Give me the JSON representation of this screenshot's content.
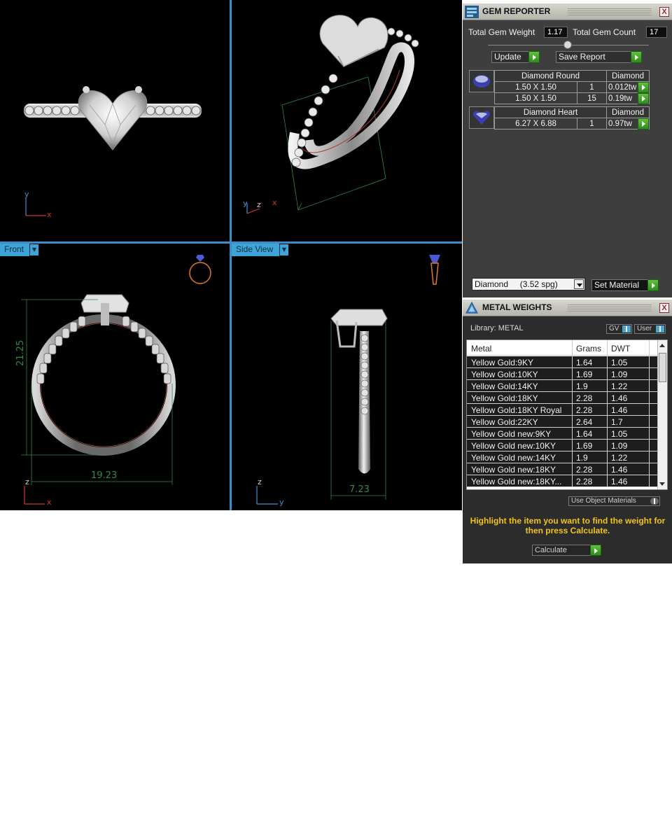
{
  "viewports": {
    "front_label": "Front",
    "side_label": "Side View",
    "top_axes": {
      "y": "y",
      "x": "x"
    },
    "persp_axes": {
      "y": "y",
      "z": "z",
      "x": "x"
    },
    "front_axes": {
      "z": "z",
      "x": "x"
    },
    "side_axes": {
      "z": "z",
      "y": "y"
    },
    "front_dims": {
      "height": "21.25",
      "width": "19.23"
    },
    "side_dims": {
      "width": "7.23"
    }
  },
  "gem_reporter": {
    "title": "GEM REPORTER",
    "close": "X",
    "total_gem_weight_label": "Total Gem Weight",
    "total_gem_weight": "1.17",
    "total_gem_count_label": "Total Gem Count",
    "total_gem_count": "17",
    "update_label": "Update",
    "save_report_label": "Save Report",
    "groups": [
      {
        "shape": "Diamond Round",
        "material": "Diamond",
        "rows": [
          {
            "size": "1.50 X 1.50",
            "count": "1",
            "weight": "0.012tw"
          },
          {
            "size": "1.50 X 1.50",
            "count": "15",
            "weight": "0.19tw"
          }
        ]
      },
      {
        "shape": "Diamond Heart",
        "material": "Diamond",
        "rows": [
          {
            "size": "6.27 X 6.88",
            "count": "1",
            "weight": "0.97tw"
          }
        ]
      }
    ],
    "material_select": "Diamond     (3.52 spg)",
    "set_material_label": "Set Material"
  },
  "metal_weights": {
    "title": "METAL WEIGHTS",
    "close": "X",
    "library_label": "Library: METAL",
    "gv_label": "GV",
    "user_label": "User",
    "columns": [
      "Metal",
      "Grams",
      "DWT"
    ],
    "rows": [
      [
        "Yellow Gold:9KY",
        "1.64",
        "1.05"
      ],
      [
        "Yellow Gold:10KY",
        "1.69",
        "1.09"
      ],
      [
        "Yellow Gold:14KY",
        "1.9",
        "1.22"
      ],
      [
        "Yellow Gold:18KY",
        "2.28",
        "1.46"
      ],
      [
        "Yellow Gold:18KY Royal",
        "2.28",
        "1.46"
      ],
      [
        "Yellow Gold:22KY",
        "2.64",
        "1.7"
      ],
      [
        "Yellow Gold new:9KY",
        "1.64",
        "1.05"
      ],
      [
        "Yellow Gold new:10KY",
        "1.69",
        "1.09"
      ],
      [
        "Yellow Gold new:14KY",
        "1.9",
        "1.22"
      ],
      [
        "Yellow Gold new:18KY",
        "2.28",
        "1.46"
      ],
      [
        "Yellow Gold new:18KY...",
        "2.28",
        "1.46"
      ]
    ],
    "use_object_materials_label": "Use Object Materials",
    "hint": "Highlight the item you want to find the weight for then press Calculate.",
    "calculate_label": "Calculate"
  },
  "colors": {
    "viewport_bg": "#000000",
    "viewport_border": "#3b8cc8",
    "dimension_line": "#2f8a4a",
    "axis_x": "#c83a2a",
    "axis_y": "#4a8ed0",
    "hint_text": "#f0c419",
    "go_button": "#3ea02a"
  }
}
